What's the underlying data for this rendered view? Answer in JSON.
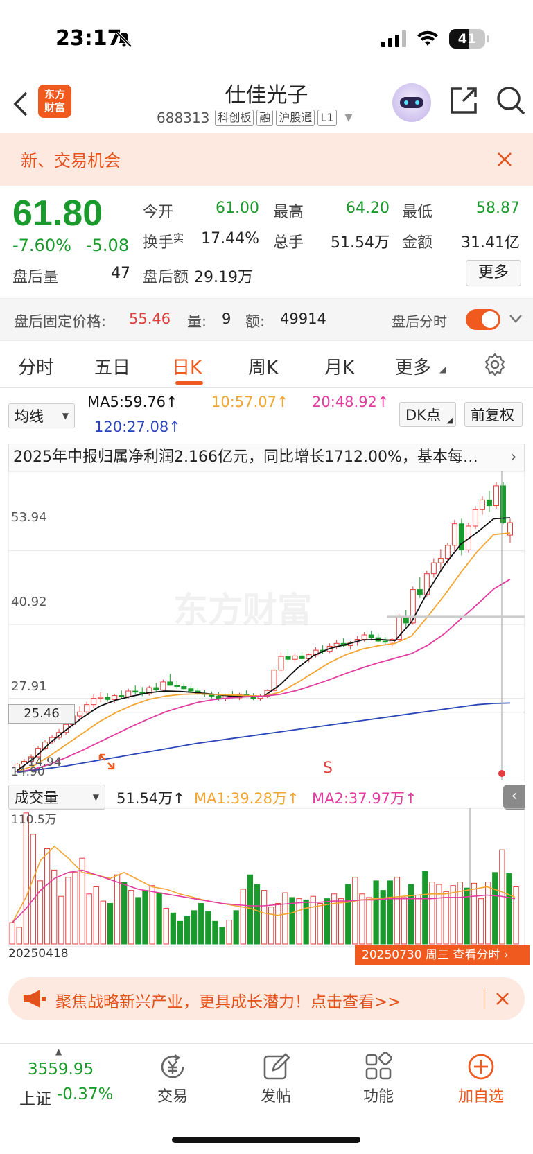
{
  "status_bar": {
    "time": "23:17",
    "battery": "41"
  },
  "header": {
    "back_icon": "back-icon",
    "logo_text": "东方\n财富",
    "title": "仕佳光子",
    "code": "688313",
    "tags": [
      "科创板",
      "融",
      "沪股通",
      "L1"
    ]
  },
  "banner": {
    "text": "新、交易机会"
  },
  "quote": {
    "price": "61.80",
    "change_pct": "-7.60%",
    "change": "-5.08",
    "after_hours_vol_label": "盘后量",
    "after_hours_vol": "47",
    "fields": [
      {
        "label": "今开",
        "value": "61.00",
        "color": "green"
      },
      {
        "label": "最高",
        "value": "64.20",
        "color": "green"
      },
      {
        "label": "最低",
        "value": "58.87",
        "color": "green"
      },
      {
        "label": "换手",
        "value": "17.44%",
        "color": "dark"
      },
      {
        "label": "总手",
        "value": "51.54万",
        "color": "dark"
      },
      {
        "label": "金额",
        "value": "31.41亿",
        "color": "dark"
      }
    ],
    "turnover_sup": "实",
    "after_hours_amt_label": "盘后额",
    "after_hours_amt": "29.19万",
    "more_label": "更多"
  },
  "fixed_price": {
    "label": "盘后固定价格:",
    "price": "55.46",
    "vol_label": "量:",
    "vol": "9",
    "amt_label": "额:",
    "amt": "49914",
    "toggle_label": "盘后分时",
    "toggle_on": true
  },
  "tabs": [
    "分时",
    "五日",
    "日K",
    "周K",
    "月K",
    "更多"
  ],
  "active_tab": "日K",
  "ma_row": {
    "select": "均线",
    "ma5": "MA5:59.76↑",
    "ma10": "10:57.07↑",
    "ma20": "20:48.92↑",
    "ma120": "120:27.08↑",
    "dk_button": "DK点",
    "adjust_button": "前复权"
  },
  "news": {
    "text": "2025年中报归属净利润2.166亿元，同比增长1712.00%，基本每…"
  },
  "chart_data": [
    {
      "type": "candlestick",
      "y_ticks": [
        "53.94",
        "40.92",
        "27.91"
      ],
      "crosshair_price": "25.46",
      "low_labels": [
        "14.94",
        "14.90"
      ],
      "signal_label": "S",
      "watermark": "东方财富",
      "ylim": [
        14.9,
        66.0
      ],
      "candles": [
        [
          15.0,
          16.5,
          14.9,
          16.3
        ],
        [
          16.3,
          17.2,
          15.8,
          16.8
        ],
        [
          16.8,
          18.0,
          16.5,
          17.6
        ],
        [
          17.6,
          19.5,
          17.3,
          19.1
        ],
        [
          19.1,
          20.5,
          18.8,
          20.2
        ],
        [
          20.2,
          21.4,
          19.8,
          21.0
        ],
        [
          21.0,
          22.5,
          20.6,
          21.9
        ],
        [
          21.9,
          23.8,
          21.5,
          23.3
        ],
        [
          23.3,
          25.2,
          22.9,
          24.8
        ],
        [
          24.8,
          26.5,
          24.0,
          25.5
        ],
        [
          25.5,
          27.3,
          25.1,
          26.8
        ],
        [
          26.8,
          28.6,
          26.2,
          27.9
        ],
        [
          27.9,
          29.0,
          27.2,
          28.1
        ],
        [
          28.1,
          28.8,
          27.3,
          27.7
        ],
        [
          27.7,
          28.7,
          27.1,
          28.4
        ],
        [
          28.4,
          29.3,
          27.8,
          28.2
        ],
        [
          28.2,
          29.6,
          27.9,
          29.2
        ],
        [
          29.2,
          30.2,
          28.6,
          29.0
        ],
        [
          29.0,
          29.9,
          28.3,
          28.7
        ],
        [
          28.7,
          30.1,
          28.4,
          29.8
        ],
        [
          29.8,
          30.6,
          29.0,
          29.4
        ],
        [
          29.4,
          31.2,
          29.1,
          30.8
        ],
        [
          30.8,
          32.2,
          30.4,
          30.2
        ],
        [
          30.2,
          30.9,
          29.6,
          30.0
        ],
        [
          30.0,
          30.7,
          29.3,
          29.6
        ],
        [
          29.6,
          30.1,
          28.9,
          29.2
        ],
        [
          29.2,
          29.8,
          28.5,
          28.8
        ],
        [
          28.8,
          29.4,
          28.2,
          28.6
        ],
        [
          28.6,
          29.1,
          27.9,
          28.3
        ],
        [
          28.3,
          29.0,
          27.5,
          27.8
        ],
        [
          27.8,
          28.7,
          27.4,
          28.4
        ],
        [
          28.4,
          29.2,
          27.9,
          28.0
        ],
        [
          28.0,
          28.9,
          27.6,
          28.6
        ],
        [
          28.6,
          29.3,
          28.1,
          28.2
        ],
        [
          28.2,
          28.8,
          27.6,
          27.9
        ],
        [
          27.9,
          28.6,
          27.5,
          28.3
        ],
        [
          28.3,
          29.5,
          28.0,
          29.3
        ],
        [
          29.3,
          33.2,
          29.0,
          32.9
        ],
        [
          32.9,
          36.0,
          32.5,
          35.3
        ],
        [
          35.3,
          36.6,
          34.3,
          34.8
        ],
        [
          34.8,
          35.9,
          34.2,
          35.4
        ],
        [
          35.4,
          36.1,
          34.6,
          34.9
        ],
        [
          34.9,
          35.8,
          34.3,
          35.6
        ],
        [
          35.6,
          36.9,
          35.1,
          36.4
        ],
        [
          36.4,
          37.3,
          35.7,
          36.2
        ],
        [
          36.2,
          37.6,
          35.9,
          37.1
        ],
        [
          37.1,
          38.2,
          36.6,
          37.6
        ],
        [
          37.6,
          38.5,
          37.0,
          37.2
        ],
        [
          37.2,
          38.0,
          36.5,
          37.8
        ],
        [
          37.8,
          38.9,
          37.2,
          38.3
        ],
        [
          38.3,
          39.6,
          37.9,
          39.1
        ],
        [
          39.1,
          39.8,
          38.1,
          38.6
        ],
        [
          38.6,
          39.3,
          37.8,
          38.0
        ],
        [
          38.0,
          38.7,
          37.4,
          37.8
        ],
        [
          37.8,
          38.5,
          37.1,
          38.3
        ],
        [
          38.3,
          42.8,
          37.9,
          42.3
        ],
        [
          42.3,
          43.5,
          40.6,
          41.2
        ],
        [
          41.2,
          47.6,
          40.9,
          47.1
        ],
        [
          47.1,
          49.3,
          45.6,
          46.2
        ],
        [
          46.2,
          50.4,
          45.8,
          49.9
        ],
        [
          49.9,
          52.6,
          49.2,
          51.8
        ],
        [
          51.8,
          54.2,
          50.6,
          52.6
        ],
        [
          52.6,
          55.3,
          51.6,
          54.9
        ],
        [
          54.9,
          59.4,
          53.9,
          58.7
        ],
        [
          58.7,
          59.6,
          53.1,
          54.1
        ],
        [
          54.1,
          58.9,
          53.6,
          58.3
        ],
        [
          58.3,
          61.8,
          57.8,
          61.2
        ],
        [
          61.2,
          63.6,
          60.3,
          62.9
        ],
        [
          62.9,
          64.5,
          60.8,
          61.9
        ],
        [
          61.9,
          66.0,
          61.3,
          65.4
        ],
        [
          65.4,
          66.0,
          58.6,
          58.9
        ],
        [
          56.7,
          59.6,
          55.3,
          58.9
        ]
      ],
      "ma_series": [
        {
          "name": "MA5",
          "color": "#111111",
          "values": [
            15.2,
            17.3,
            20.1,
            22.4,
            24.6,
            26.5,
            27.6,
            28.3,
            28.9,
            29.2,
            29.1,
            28.9,
            28.6,
            28.3,
            28.2,
            28.3,
            30.3,
            33.1,
            35.4,
            36.7,
            37.4,
            38.2,
            38.3,
            38.1,
            41.4,
            46.8,
            51.4,
            55.1,
            57.2,
            59.6,
            59.76
          ]
        },
        {
          "name": "MA10",
          "color": "#f2a531",
          "values": [
            15.0,
            16.0,
            17.8,
            19.8,
            21.8,
            23.8,
            25.4,
            26.7,
            27.7,
            28.3,
            28.6,
            28.7,
            28.6,
            28.5,
            28.4,
            28.3,
            29.0,
            30.6,
            32.4,
            34.2,
            35.6,
            36.6,
            37.2,
            37.6,
            38.9,
            42.4,
            46.1,
            50.1,
            53.8,
            56.8,
            57.07
          ]
        },
        {
          "name": "MA20",
          "color": "#e23ca0",
          "values": [
            14.9,
            15.4,
            16.3,
            17.5,
            18.8,
            20.2,
            21.6,
            23.0,
            24.3,
            25.5,
            26.4,
            27.2,
            27.7,
            28.0,
            28.2,
            28.3,
            28.6,
            29.3,
            30.2,
            31.2,
            32.3,
            33.3,
            34.2,
            35.0,
            35.8,
            37.3,
            39.3,
            41.9,
            44.5,
            47.2,
            48.92
          ]
        },
        {
          "name": "MA120",
          "color": "#2b45b8",
          "values": [
            14.9,
            15.2,
            15.6,
            16.0,
            16.5,
            17.0,
            17.5,
            18.0,
            18.5,
            19.0,
            19.5,
            20.0,
            20.4,
            20.8,
            21.2,
            21.6,
            22.0,
            22.4,
            22.8,
            23.2,
            23.6,
            24.0,
            24.4,
            24.8,
            25.2,
            25.6,
            26.0,
            26.4,
            26.8,
            27.0,
            27.08
          ]
        }
      ]
    },
    {
      "type": "bar",
      "top_label": "110.5万",
      "start_date": "20250418",
      "end_label": "20250730 周三 查看分时",
      "volume_label": "成交量",
      "vol_value": "51.54万↑",
      "ma1": "MA1:39.28万↑",
      "ma2": "MA2:37.97万↑",
      "ylim": [
        0,
        110.5
      ],
      "volumes": [
        18,
        14,
        110,
        92,
        53,
        80,
        62,
        40,
        56,
        60,
        72,
        42,
        48,
        36,
        34,
        58,
        52,
        45,
        39,
        45,
        49,
        43,
        30,
        26,
        19,
        23,
        28,
        34,
        27,
        19,
        14,
        20,
        28,
        46,
        58,
        50,
        45,
        31,
        34,
        43,
        39,
        38,
        37,
        40,
        34,
        38,
        42,
        38,
        50,
        56,
        42,
        39,
        53,
        45,
        53,
        56,
        39,
        50,
        41,
        61,
        52,
        50,
        44,
        49,
        52,
        47,
        51,
        38,
        52,
        60,
        79,
        59,
        48
      ],
      "ma1_values": [
        18,
        40,
        70,
        82,
        72,
        60,
        58,
        55,
        60,
        54,
        48,
        46,
        42,
        39,
        36,
        34,
        32,
        30,
        26,
        24,
        26,
        30,
        32,
        34,
        35,
        37,
        38,
        39,
        40,
        41,
        42,
        42,
        44,
        46,
        48,
        44,
        39.28
      ],
      "ma2_values": [
        18,
        30,
        45,
        55,
        60,
        62,
        58,
        54,
        50,
        46,
        44,
        42,
        40,
        38,
        36,
        34,
        33,
        32,
        32,
        33,
        34,
        35,
        35,
        36,
        36,
        37,
        37,
        38,
        38,
        38,
        38,
        39,
        39,
        40,
        41,
        40,
        37.97
      ]
    }
  ],
  "promo": {
    "text": "聚焦战略新兴产业，更具成长潜力！点击查看>>"
  },
  "bottom_bar": {
    "index_value": "3559.95",
    "index_name": "上证",
    "index_change": "-0.37%",
    "items": [
      "交易",
      "发帖",
      "功能",
      "加自选"
    ]
  },
  "colors": {
    "up": "#e23c3c",
    "down": "#1a9a2c",
    "accent": "#f05a1e"
  }
}
